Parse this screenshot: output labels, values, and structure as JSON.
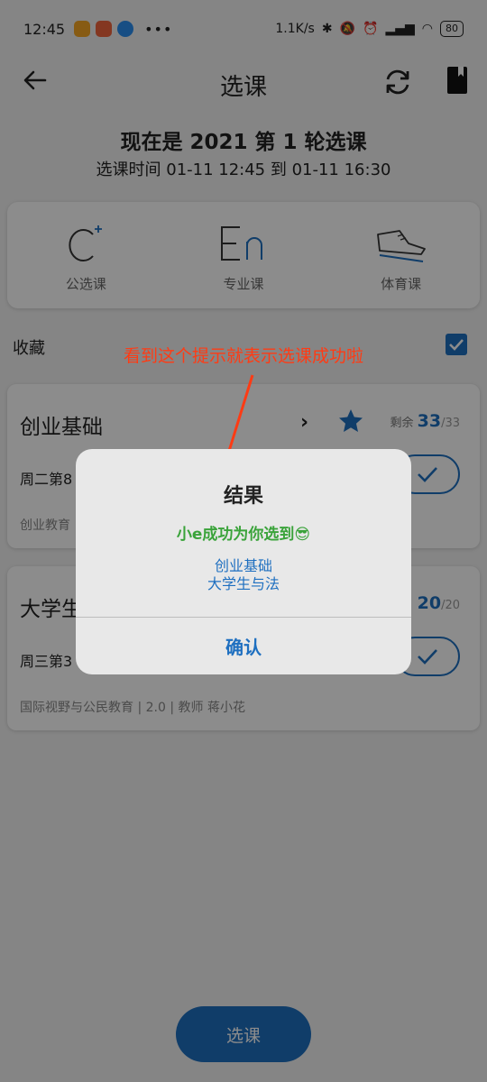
{
  "status_bar": {
    "time": "12:45",
    "dots": "•••",
    "speed": "1.1K/s",
    "battery": "80"
  },
  "toolbar": {
    "title": "选课"
  },
  "heading": "现在是 2021 第 1 轮选课",
  "subheading": "选课时间 01-11 12:45 到 01-11 16:30",
  "categories": [
    {
      "label": "公选课",
      "icon": "public-course-icon"
    },
    {
      "label": "专业课",
      "icon": "major-course-icon"
    },
    {
      "label": "体育课",
      "icon": "pe-course-icon"
    }
  ],
  "favorite": {
    "label": "收藏",
    "checked": true
  },
  "annotation": "看到这个提示就表示选课成功啦",
  "courses": [
    {
      "name": "创业基础",
      "chevron": "›",
      "remain_label": "剩余",
      "remain": "33",
      "max": "/33",
      "time": "周二第8",
      "meta": "创业教育"
    },
    {
      "name": "大学生",
      "remain": "20",
      "max": "/20",
      "time": "周三第3",
      "meta": "国际视野与公民教育 | 2.0 | 教师 蒋小花"
    }
  ],
  "select_button": "选课",
  "dialog": {
    "title": "结果",
    "message": "小e成功为你选到😎",
    "courses": [
      "创业基础",
      "大学生与法"
    ],
    "ok": "确认"
  },
  "colors": {
    "accent": "#1e6fc0",
    "success": "#3aa33a",
    "annotation": "#ff3b14"
  }
}
